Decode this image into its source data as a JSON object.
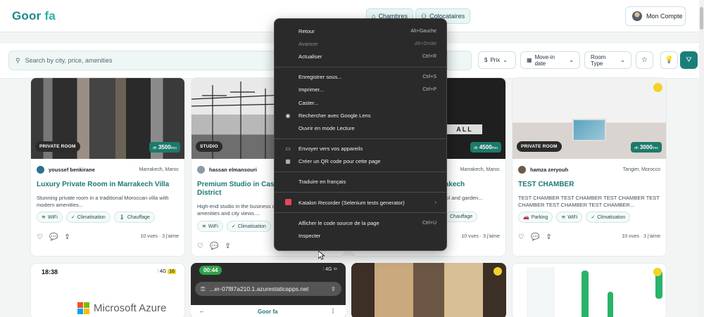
{
  "app": {
    "logo_part1": "Goor",
    "logo_part2": "fa"
  },
  "nav": {
    "chambres": "Chambres",
    "colocataires": "Colocataires",
    "account": "Mon Compte"
  },
  "filters": {
    "search_placeholder": "Search by city, price, amenities",
    "prix": "Prix",
    "move_in": "Move-in date",
    "room_type": "Room Type"
  },
  "listings": [
    {
      "badge": "PRIVATE ROOM",
      "price": "3500",
      "currency": "dh",
      "per": "/mo",
      "owner": "youssef benkirane",
      "city": "Marrakech, Maroc",
      "title": "Luxury Private Room in Marrakech Villa",
      "desc": "Stunning private room in a traditional Moroccan villa with modern amenities...",
      "tags": [
        "WiFi",
        "Climatisation",
        "Chauffage"
      ],
      "views": "10 vues",
      "likes": "3 j'aime"
    },
    {
      "badge": "STUDIO",
      "owner": "hassan elmansouri",
      "title": "Premium Studio in Casablanca Business District",
      "desc": "High-end studio in the business district with premium amenities and city views....",
      "tags": [
        "WiFi",
        "Climatisation"
      ]
    },
    {
      "price": "4500",
      "currency": "dh",
      "per": "/mo",
      "city": "Marrakech, Maroc",
      "title": "Private Villa Room in Marrakech",
      "desc": "Beautiful room in a luxury villa with pool and garden...",
      "tags": [
        "Chauffage"
      ],
      "views": "10 vues",
      "likes": "3 j'aime"
    },
    {
      "badge": "PRIVATE ROOM",
      "price": "3000",
      "currency": "dh",
      "per": "/mo",
      "owner": "hamza zeryouh",
      "city": "Tangier, Morocco",
      "title": "TEST CHAMBER",
      "desc": "TEST CHAMBER TEST CHAMBER TEST CHAMBER TEST CHAMBER TEST CHAMBER TEST CHAMBER...",
      "tags": [
        "Parking",
        "WiFi",
        "Climatisation"
      ],
      "views": "10 vues",
      "likes": "3 j'aime"
    }
  ],
  "row_two": {
    "azure_time": "18:38",
    "azure_signal": "4G",
    "azure_battery": "16",
    "azure_brand": "Microsoft Azure",
    "phone_time": "00:44",
    "phone_signal": "4G",
    "phone_url": "...er-07f87a210.1.azurestaticapps.net",
    "phone_logo": "Goor fa"
  },
  "context_menu": [
    {
      "label": "Retour",
      "shortcut": "Alt+Gauche"
    },
    {
      "label": "Avancer",
      "shortcut": "Alt+Droite",
      "disabled": true
    },
    {
      "label": "Actualiser",
      "shortcut": "Ctrl+R"
    },
    {
      "label": "Enregistrer sous...",
      "shortcut": "Ctrl+S"
    },
    {
      "label": "Imprimer...",
      "shortcut": "Ctrl+P"
    },
    {
      "label": "Caster..."
    },
    {
      "label": "Rechercher avec Google Lens",
      "icon": "lens-icon"
    },
    {
      "label": "Ouvrir en mode Lecture"
    },
    {
      "label": "Envoyer vers vos appareils",
      "icon": "devices-icon"
    },
    {
      "label": "Créer un QR code pour cette page",
      "icon": "qr-icon"
    },
    {
      "label": "Traduire en français"
    },
    {
      "label": "Katalon Recorder (Selenium tests generator)",
      "icon": "katalon-icon"
    },
    {
      "label": "Afficher le code source de la page",
      "shortcut": "Ctrl+U"
    },
    {
      "label": "Inspecter"
    }
  ]
}
